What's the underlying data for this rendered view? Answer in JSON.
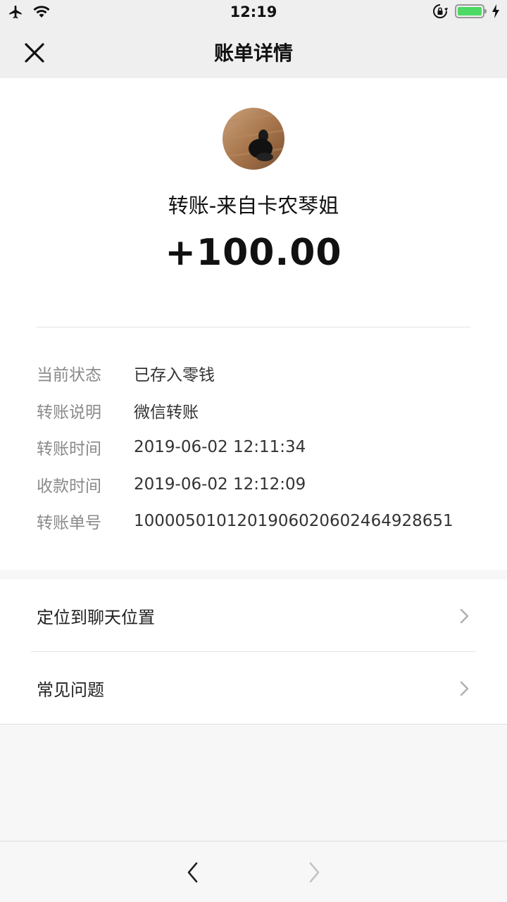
{
  "status_bar": {
    "time": "12:19",
    "icons": [
      "airplane-icon",
      "wifi-icon",
      "rotation-lock-icon",
      "battery-icon",
      "charging-icon"
    ],
    "battery_level": 1.0
  },
  "nav": {
    "title": "账单详情",
    "close_icon": "close-icon"
  },
  "transfer": {
    "from_label": "转账-来自卡农琴姐",
    "amount": "+100.00",
    "details": [
      {
        "key": "当前状态",
        "value": "已存入零钱"
      },
      {
        "key": "转账说明",
        "value": "微信转账"
      },
      {
        "key": "转账时间",
        "value": "2019-06-02 12:11:34"
      },
      {
        "key": "收款时间",
        "value": "2019-06-02 12:12:09"
      },
      {
        "key": "转账单号",
        "value": "1000050101201906020602464928651"
      }
    ]
  },
  "links": [
    {
      "label": "定位到聊天位置",
      "icon": "chevron-right-icon"
    },
    {
      "label": "常见问题",
      "icon": "chevron-right-icon"
    }
  ],
  "toolbar": {
    "back_icon": "back-arrow-icon",
    "forward_icon": "forward-arrow-icon"
  },
  "colors": {
    "nav_bg": "#efefef",
    "page_bg": "#f7f7f7",
    "card_bg": "#ffffff",
    "battery_green": "#4cd964",
    "label_gray": "#8a8a8a"
  }
}
